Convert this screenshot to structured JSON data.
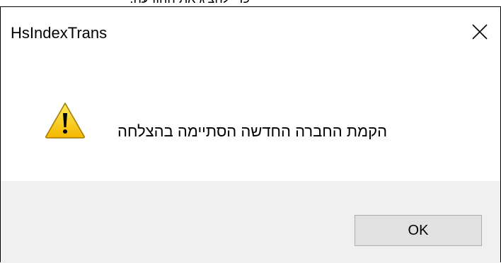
{
  "background_text": "כדי להציג את ההודעה.",
  "dialog": {
    "title": "HsIndexTrans",
    "close_glyph": "✕",
    "message": "הקמת החברה החדשה הסתיימה בהצלחה",
    "icon": "warning-icon",
    "ok_label": "OK"
  },
  "colors": {
    "footer_bg": "#f0f0f0",
    "button_bg": "#e1e1e1",
    "button_border": "#adadad",
    "warning_fill": "#ffd000",
    "warning_border": "#a07800"
  }
}
